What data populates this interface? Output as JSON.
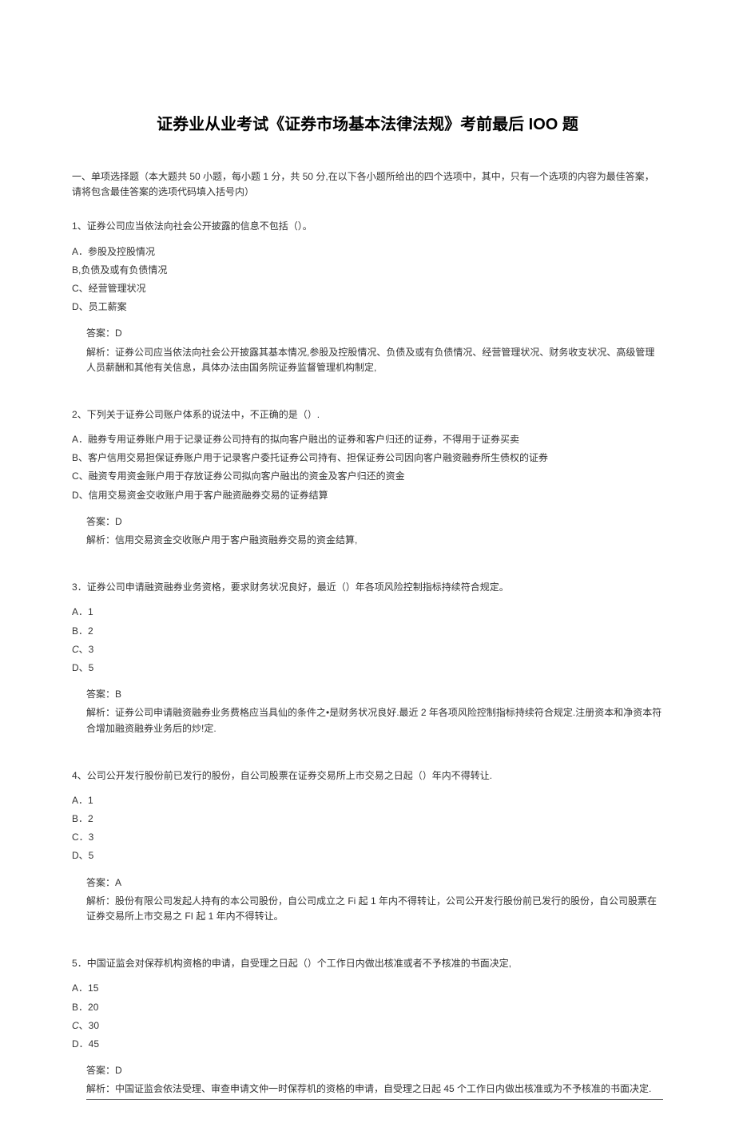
{
  "title": "证券业从业考试《证券市场基本法律法规》考前最后 IOO 题",
  "instructions": "一、单项选择题（本大题共 50 小题，每小题 1 分，共 50 分,在以下各小题所给出的四个选项中，其中，只有一个选项的内容为最佳答案，请将包含最佳答案的选项代码填入括号内）",
  "questions": [
    {
      "number": "1",
      "text": "、证券公司应当依法向社会公开披露的信息不包括（）。",
      "options": [
        {
          "label": "A",
          "text": "．参股及控股情况"
        },
        {
          "label": "B",
          "text": ",负债及或有负债情况"
        },
        {
          "label": "C",
          "text": "、经营管理状况"
        },
        {
          "label": "D",
          "text": "、员工薪案"
        }
      ],
      "answer": "答案：D",
      "explanation": "解析：证券公司应当依法向社会公开披露其基本情况,参股及控股情况、负债及或有负债情况、经营管理状况、财务收支状况、高级管理人员薪酬和其他有关信息，具体办法由国务院证券监督管理机构制定,"
    },
    {
      "number": "2",
      "text": "、下列关于证券公司账户体系的说法中，不正确的是（）.",
      "options": [
        {
          "label": "A",
          "text": "．融券专用证券账户用于记录证券公司持有的拟向客户融出的证券和客户归还的证券，不得用于证券买卖"
        },
        {
          "label": "B",
          "text": "、客户信用交易担保证券账户用于记录客户委托证券公司持有、担保证券公司因向客户融资融券所生债权的证券"
        },
        {
          "label": "C",
          "text": "、融资专用资金账户用于存放证券公司拟向客户融出的资金及客户归还的资金"
        },
        {
          "label": "D",
          "text": "、信用交易资金交收账户用于客户融资融券交易的证券结算"
        }
      ],
      "answer": "答案：D",
      "explanation": "解析：信用交易资金交收账户用于客户融资融券交易的资金结算,"
    },
    {
      "number": "3",
      "text": "．证券公司申请融资融券业务资格，要求财务状况良好，最近（）年各项风险控制指标持续符合规定。",
      "options": [
        {
          "label": "A",
          "text": "．1"
        },
        {
          "label": "B",
          "text": "．2"
        },
        {
          "label": "C",
          "text": "、3"
        },
        {
          "label": "D",
          "text": "、5"
        }
      ],
      "answer": "答案：B",
      "explanation": "解析：证券公司申请融资融券业务费格应当具仙的条件之•是财务状况良好.最近 2 年各项风险控制指标持续符合规定.注册资本和净资本符合增加融资融券业务后的炒!定."
    },
    {
      "number": "4",
      "text": "、公司公开发行股份前已发行的股份，自公司股票在证券交易所上市交易之日起（）年内不得转让.",
      "options": [
        {
          "label": "A",
          "text": "．1"
        },
        {
          "label": "B",
          "text": "．2"
        },
        {
          "label": "C",
          "text": "．3"
        },
        {
          "label": "D",
          "text": "、5"
        }
      ],
      "answer": "答案：A",
      "explanation": "解析：股份有限公司发起人持有的本公司股份，自公司成立之 Fi 起 1 年内不得转让，公司公开发行股份前已发行的股份，自公司股票在证券交易所上市交易之 FI 起 1 年内不得转让。"
    },
    {
      "number": "5",
      "text": "．中国证监会对保荐机构资格的申请，自受理之日起（）个工作日内做出核准或者不予核准的书面决定,",
      "options": [
        {
          "label": "A",
          "text": "．15"
        },
        {
          "label": "B",
          "text": "．20"
        },
        {
          "label": "C",
          "text": "、30"
        },
        {
          "label": "D",
          "text": "．45"
        }
      ],
      "answer": "答案：D",
      "explanation": "解析：中国证监会依法受理、审查申请文仲一时保荐机的资格的申请，自受理之日起 45 个工作日内做出核准或为不予核准的书面决定."
    }
  ]
}
